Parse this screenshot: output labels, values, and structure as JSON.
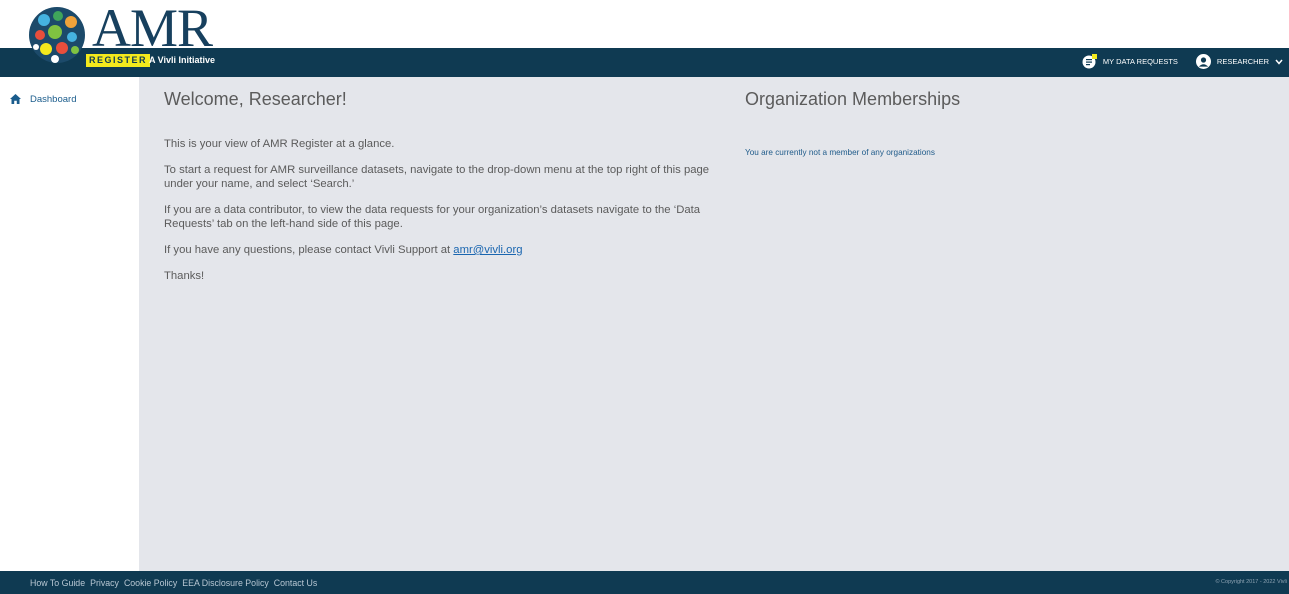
{
  "brand": {
    "logo_text": "AMR",
    "register_label": "REGISTER",
    "tagline": "A Vivli Initiative"
  },
  "header": {
    "my_data_requests": "MY DATA REQUESTS",
    "user_menu": "RESEARCHER"
  },
  "sidebar": {
    "items": [
      {
        "label": "Dashboard",
        "icon": "home-icon"
      }
    ]
  },
  "welcome": {
    "title": "Welcome, Researcher!",
    "p1": "This is your view of AMR Register at a glance.",
    "p2": "To start a request for AMR surveillance datasets, navigate to the drop-down menu at the top right of this page under your name, and select ‘Search.’",
    "p3": "If you are a data contributor, to view the data requests for your organization’s datasets navigate to the ‘Data Requests’ tab on the left-hand side of this page.",
    "p4_prefix": "If you have any questions, please contact Vivli Support at ",
    "support_email": "amr@vivli.org",
    "thanks": "Thanks!"
  },
  "organizations": {
    "title": "Organization Memberships",
    "empty_message": "You are currently not a member of any organizations"
  },
  "footer": {
    "links": [
      "How To Guide",
      "Privacy",
      "Cookie Policy",
      "EEA Disclosure Policy",
      "Contact Us"
    ],
    "copyright": "© Copyright 2017 - 2022 Vivli"
  },
  "colors": {
    "header_bg": "#0f3a52",
    "badge_yellow": "#f3e91d",
    "content_bg": "#e4e6eb",
    "link_blue": "#1a66b0"
  }
}
